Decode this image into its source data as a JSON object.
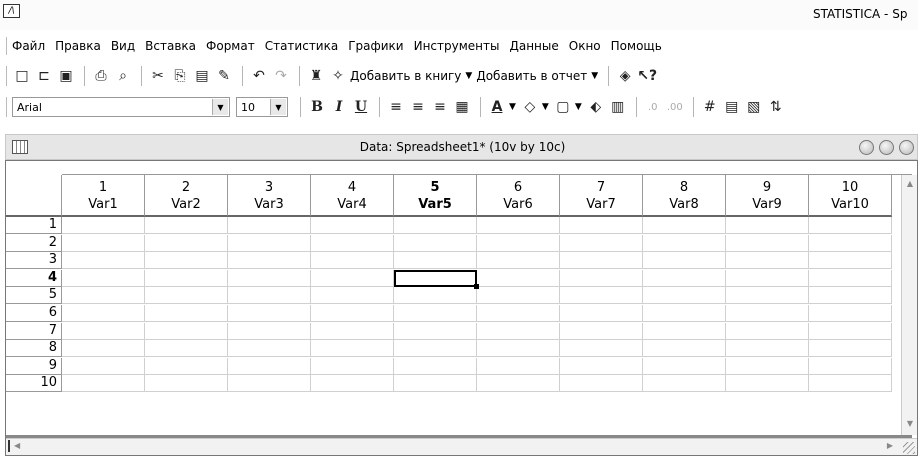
{
  "app": {
    "title": "STATISTICA - Sp",
    "icon": "statistica-logo"
  },
  "menu": [
    "Файл",
    "Правка",
    "Вид",
    "Вставка",
    "Формат",
    "Статистика",
    "Графики",
    "Инструменты",
    "Данные",
    "Окно",
    "Помощь"
  ],
  "toolbar1": {
    "add_to_book": "Добавить в книгу",
    "add_to_report": "Добавить в отчет"
  },
  "toolbar2": {
    "font_name": "Arial",
    "font_size": "10",
    "bold": "B",
    "italic": "I",
    "underline": "U"
  },
  "document": {
    "title": "Data: Spreadsheet1* (10v by 10c)"
  },
  "spreadsheet": {
    "columns": [
      {
        "num": "1",
        "name": "Var1"
      },
      {
        "num": "2",
        "name": "Var2"
      },
      {
        "num": "3",
        "name": "Var3"
      },
      {
        "num": "4",
        "name": "Var4"
      },
      {
        "num": "5",
        "name": "Var5"
      },
      {
        "num": "6",
        "name": "Var6"
      },
      {
        "num": "7",
        "name": "Var7"
      },
      {
        "num": "8",
        "name": "Var8"
      },
      {
        "num": "9",
        "name": "Var9"
      },
      {
        "num": "10",
        "name": "Var10"
      }
    ],
    "rows": [
      "1",
      "2",
      "3",
      "4",
      "5",
      "6",
      "7",
      "8",
      "9",
      "10"
    ],
    "active_row": "4",
    "active_column": "5"
  }
}
